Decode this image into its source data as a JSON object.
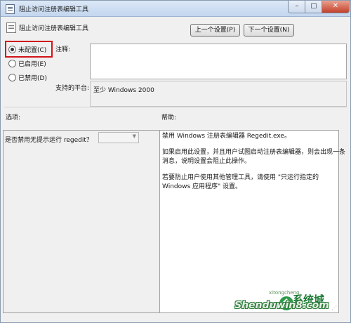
{
  "window": {
    "title": "阻止访问注册表编辑工具",
    "min": "–",
    "max": "▢",
    "close": "✕"
  },
  "header": {
    "title": "阻止访问注册表编辑工具"
  },
  "nav": {
    "prev": "上一个设置(P)",
    "next": "下一个设置(N)"
  },
  "state": {
    "options": [
      {
        "label": "未配置(C)",
        "selected": true
      },
      {
        "label": "已启用(E)",
        "selected": false
      },
      {
        "label": "已禁用(D)",
        "selected": false
      }
    ]
  },
  "comment": {
    "label": "注释:",
    "value": ""
  },
  "platform": {
    "label": "支持的平台:",
    "value": "至少 Windows 2000"
  },
  "options_pane": {
    "label": "选项:",
    "setting_label": "是否禁用无提示运行 regedit？",
    "select_value": ""
  },
  "help_pane": {
    "label": "帮助:",
    "p1": "禁用 Windows 注册表编辑器 Regedit.exe。",
    "p2a": "如果启用此设置，并且用户试图启动注册表编辑器，则会出现一条",
    "p2b": "消息，说明设置会阻止此操作。",
    "p3a": "若要防止用户使用其他管理工具，请使用 \"只运行指定的",
    "p3b": "Windows 应用程序\" 设置。"
  },
  "watermark": {
    "site": "Shenduwin8.com",
    "brand": "系统城",
    "sub": "xitongcheng"
  },
  "colors": {
    "highlight": "#d1141b",
    "watermark": "#1b7a33"
  }
}
